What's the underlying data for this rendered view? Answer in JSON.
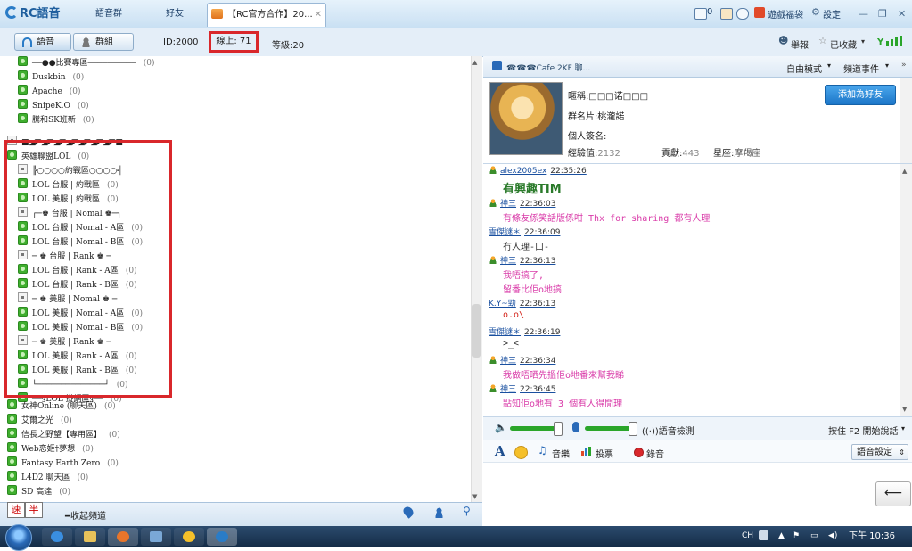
{
  "titlebar": {
    "app_name": "RC語音",
    "tabs": [
      "語音群",
      "好友"
    ],
    "active_tab": "【RC官方合作】20...",
    "mail_count": "0",
    "gift": "遊戲福袋",
    "settings": "設定"
  },
  "bar2": {
    "voice_tab": "語音",
    "group_tab": "群組",
    "id": "ID:2000",
    "online": "線上: 71",
    "level": "等級:20",
    "report": "舉報",
    "favorite": "已收藏"
  },
  "channels": [
    {
      "label": "━━●●比賽專區━━━━━━━━━━",
      "count": "(0)",
      "kind": "room"
    },
    {
      "label": "Duskbin",
      "count": "(0)",
      "kind": "room"
    },
    {
      "label": "Apache",
      "count": "(0)",
      "kind": "room"
    },
    {
      "label": "SnipeK.O",
      "count": "(0)",
      "kind": "room"
    },
    {
      "label": "騰和SK班新",
      "count": "(0)",
      "kind": "room"
    },
    {
      "label": "■◢◤◢◤◢◤◢◤◢◤◢◤◢◤■",
      "count": "",
      "kind": "group"
    },
    {
      "label": "英雄聯盟LOL",
      "count": "(0)",
      "kind": "group"
    },
    {
      "label": "╠○○○○約戰區○○○○╣",
      "count": "",
      "kind": "sub"
    },
    {
      "label": "LOL 台服 | 約戰區",
      "count": "(0)",
      "kind": "room"
    },
    {
      "label": "LOL 美服 | 約戰區",
      "count": "(0)",
      "kind": "room"
    },
    {
      "label": "┌─♚ 台服 | Nomal ♚─┐",
      "count": "",
      "kind": "sub"
    },
    {
      "label": "LOL 台服 | Nomal - A區",
      "count": "(0)",
      "kind": "room"
    },
    {
      "label": "LOL 台服 | Nomal - B區",
      "count": "(0)",
      "kind": "room"
    },
    {
      "label": "─ ♚ 台服 | Rank ♚ ─",
      "count": "",
      "kind": "sub"
    },
    {
      "label": "LOL 台服 | Rank - A區",
      "count": "(0)",
      "kind": "room"
    },
    {
      "label": "LOL 台服 | Rank - B區",
      "count": "(0)",
      "kind": "room"
    },
    {
      "label": "─ ♚ 美服 | Nomal ♚ ─",
      "count": "",
      "kind": "sub"
    },
    {
      "label": "LOL 美服 | Nomal - A區",
      "count": "(0)",
      "kind": "room"
    },
    {
      "label": "LOL 美服 | Nomal - B區",
      "count": "(0)",
      "kind": "room"
    },
    {
      "label": "─ ♚ 美服 | Rank ♚ ─",
      "count": "",
      "kind": "sub"
    },
    {
      "label": "LOL 美服 | Rank - A區",
      "count": "(0)",
      "kind": "room"
    },
    {
      "label": "LOL 美服 | Rank - B區",
      "count": "(0)",
      "kind": "room"
    },
    {
      "label": "└──────────────┘",
      "count": "(0)",
      "kind": "room"
    },
    {
      "label": "──§LOL 掛網區§──",
      "count": "(0)",
      "kind": "room"
    },
    {
      "label": "女神Online (聊天區)",
      "count": "(0)",
      "kind": "room"
    },
    {
      "label": "艾爾之光",
      "count": "(0)",
      "kind": "room"
    },
    {
      "label": "信長之野望【專用區】",
      "count": "(0)",
      "kind": "room"
    },
    {
      "label": "Web恋姬†夢想",
      "count": "(0)",
      "kind": "room"
    },
    {
      "label": "Fantasy Earth Zero",
      "count": "(0)",
      "kind": "room"
    },
    {
      "label": "L4D2 聊天區",
      "count": "(0)",
      "kind": "room"
    },
    {
      "label": "SD 高達",
      "count": "(0)",
      "kind": "room"
    }
  ],
  "left_bottom": {
    "ime1": "速",
    "ime2": "半",
    "collapse": "━收起頻道"
  },
  "right": {
    "channel_title": "☎☎☎Cafe 2KF 聊...",
    "free_mode": "自由模式",
    "channel_events": "頻道事件",
    "nickname": "暱稱:□□□诺□□□",
    "group_card": "群名片:桃瀧諾",
    "signature": "個人簽名:",
    "exp_label": "經驗值:",
    "exp": "2132",
    "contrib_label": "貢獻:",
    "contrib": "443",
    "sign_label": "星座:",
    "zodiac": "摩羯座",
    "add_friend": "添加為好友"
  },
  "chat": [
    {
      "name": "alex2005ex",
      "time": "22:35:26",
      "lines": [
        "有興趣TIM"
      ],
      "color": "#2a7a2a",
      "big": true,
      "icon": true
    },
    {
      "name": "神三",
      "time": "22:36:03",
      "lines": [
        "有條友係笑話版係咁 Thx for sharing 都有人理"
      ],
      "color": "#d93aa8",
      "icon": true
    },
    {
      "name": "雪傑謎＊",
      "time": "22:36:09",
      "lines": [
        "冇人理-口-"
      ],
      "color": "#333333",
      "icon": false
    },
    {
      "name": "神三",
      "time": "22:36:13",
      "lines": [
        "我唔搞了,",
        "留番比佢o地搞"
      ],
      "color": "#d93aa8",
      "icon": true
    },
    {
      "name": "K.Y~勁",
      "time": "22:36:13",
      "lines": [
        "o.o\\"
      ],
      "color": "#d4261c",
      "icon": false
    },
    {
      "name": "雪傑謎＊",
      "time": "22:36:19",
      "lines": [
        ">_<"
      ],
      "color": "#333333",
      "icon": false
    },
    {
      "name": "神三",
      "time": "22:36:34",
      "lines": [
        "我做唔晒先搵佢o地番來幫我睇"
      ],
      "color": "#d93aa8",
      "icon": true
    },
    {
      "name": "神三",
      "time": "22:36:45",
      "lines": [
        "點知佢o地有 3 個有人得閒理"
      ],
      "color": "#d93aa8",
      "icon": true
    }
  ],
  "volume": {
    "speaker_level": 0.95,
    "mic_level": 0.95,
    "detect": "((·))語音檢測",
    "hotkey": "按住 F2 開始說話"
  },
  "toolbar": {
    "font_icon": "A",
    "music": "音樂",
    "vote": "投票",
    "record": "錄音",
    "voice_settings": "語音設定"
  },
  "taskbar": {
    "lang": "CH",
    "time": "下午 10:36"
  }
}
